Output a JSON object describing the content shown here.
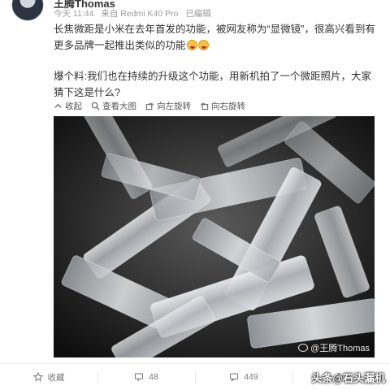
{
  "post": {
    "user_name": "王腾Thomas",
    "time": "今天 11:44",
    "source": "来自 Redmi K40 Pro",
    "edited": "已编辑",
    "text_1": "长焦微距是小米在去年首发的功能，被网友称为“显微镜”，很高兴看到有更多品牌一起推出类似的功能",
    "text_2": "爆个料:我们也在持续的升级这个功能，用新机拍了一个微距照片，大家猜下这是什么?"
  },
  "image_toolbar": {
    "collapse": "收起",
    "view_large": "查看大图",
    "rotate_left": "向左旋转",
    "rotate_right": "向右旋转"
  },
  "photo": {
    "watermark": "@王腾Thomas"
  },
  "actions": {
    "favorite": "收藏",
    "repost_count": "48",
    "comment_count": "449"
  },
  "overlay": {
    "brand": "头条@石头漏机"
  }
}
